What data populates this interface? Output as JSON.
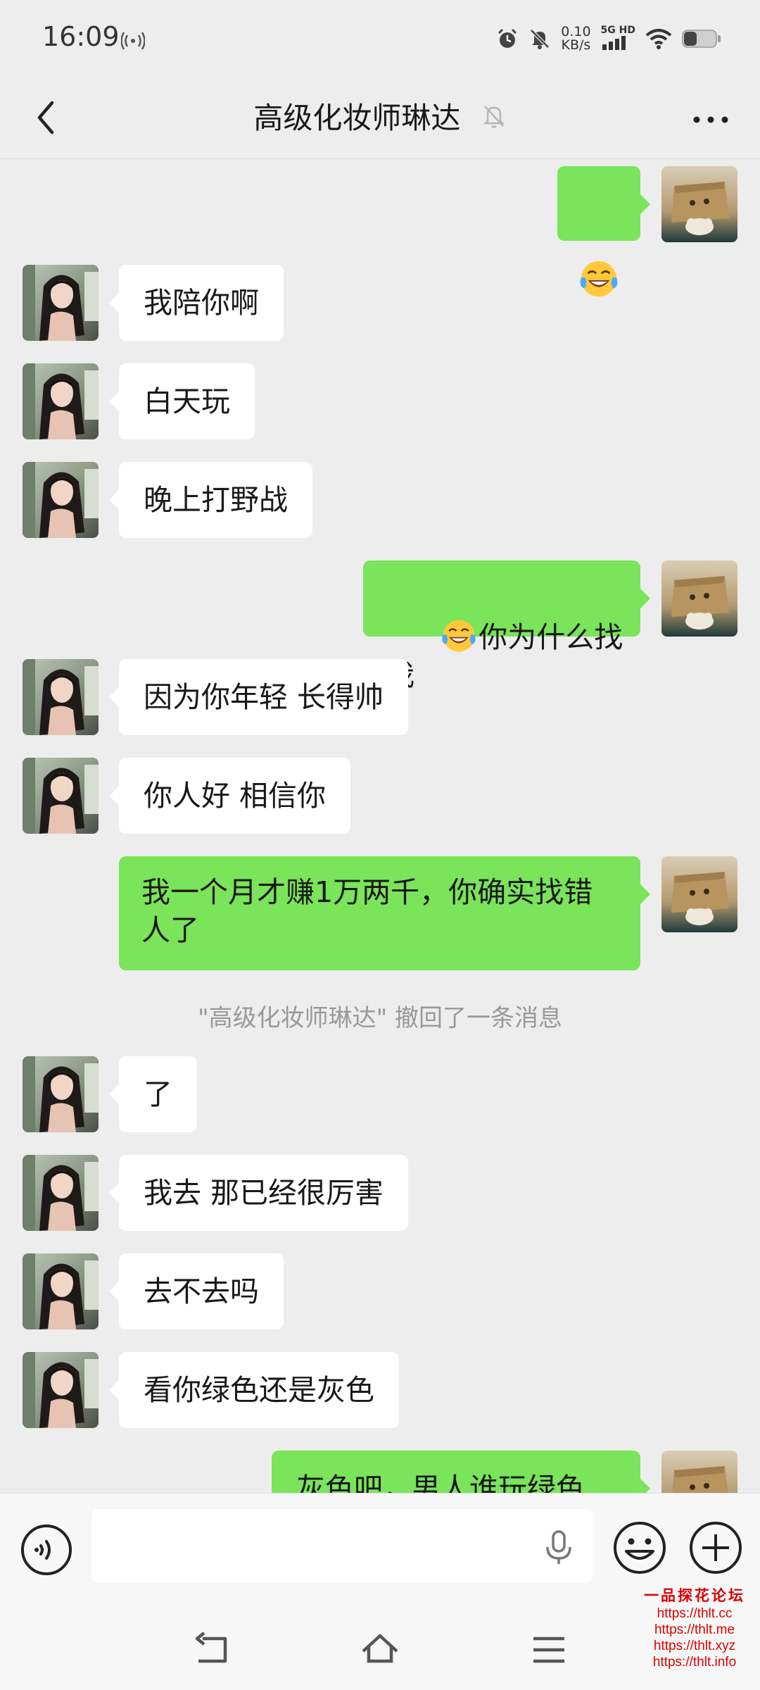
{
  "status_bar": {
    "time": "16:09",
    "net_speed_value": "0.10",
    "net_speed_unit": "KB/s",
    "network_type": "5G HD",
    "icons": [
      "radio-wave-icon",
      "alarm-icon",
      "muted-bell-icon",
      "signal-icon",
      "wifi-icon",
      "battery-icon"
    ]
  },
  "header": {
    "title": "高级化妆师琳达",
    "icons": [
      "back-icon",
      "mute-bell-icon",
      "more-icon"
    ]
  },
  "messages": [
    {
      "from": "me",
      "text": "",
      "emoji": "laughing-crying-emoji"
    },
    {
      "from": "them",
      "text": "我陪你啊"
    },
    {
      "from": "them",
      "text": "白天玩"
    },
    {
      "from": "them",
      "text": "晚上打野战"
    },
    {
      "from": "me",
      "text": "你为什么找我",
      "emoji": "laughing-crying-emoji"
    },
    {
      "from": "them",
      "text": "因为你年轻 长得帅"
    },
    {
      "from": "them",
      "text": "你人好 相信你"
    },
    {
      "from": "me",
      "text": "我一个月才赚1万两千，你确实找错人了"
    },
    {
      "from": "them",
      "text": "了"
    },
    {
      "from": "them",
      "text": "我去 那已经很厉害"
    },
    {
      "from": "them",
      "text": "去不去吗"
    },
    {
      "from": "them",
      "text": "看你绿色还是灰色"
    },
    {
      "from": "me",
      "text": "灰色吧，男人谁玩绿色"
    }
  ],
  "system_notice": "\"高级化妆师琳达\" 撤回了一条消息",
  "input_bar": {
    "placeholder": "",
    "icons": [
      "voice-input-icon",
      "microphone-icon",
      "emoji-icon",
      "plus-icon"
    ]
  },
  "nav_bar": {
    "icons": [
      "back-nav-icon",
      "home-nav-icon",
      "menu-nav-icon"
    ]
  },
  "watermark": {
    "title": "一品探花论坛",
    "urls": [
      "https://thlt.cc",
      "https://thlt.me",
      "https://thlt.xyz",
      "https://thlt.info"
    ]
  },
  "colors": {
    "background": "#ededed",
    "outgoing_bubble": "#7ae45a",
    "incoming_bubble": "#ffffff",
    "watermark": "#dd0000"
  }
}
